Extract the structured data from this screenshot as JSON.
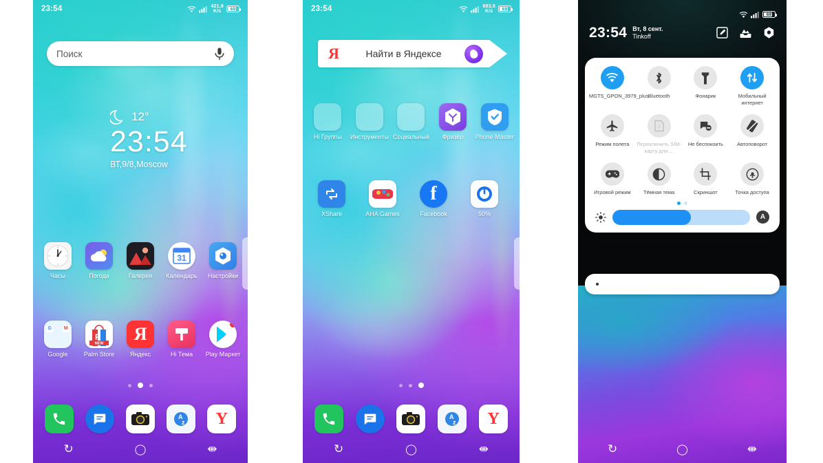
{
  "phone1": {
    "status": {
      "time": "23:54",
      "net_speed": "421,9",
      "net_unit": "K/s",
      "battery": "69"
    },
    "search": {
      "placeholder": "Поиск",
      "mic_icon": "microphone-icon"
    },
    "clock_widget": {
      "temp": "12°",
      "time": "23:54",
      "date": "ВТ,9/8,Moscow",
      "weather_icon": "moon-icon"
    },
    "row1": [
      {
        "label": "Часы",
        "icon": "clock-app-icon"
      },
      {
        "label": "Погода",
        "icon": "weather-app-icon"
      },
      {
        "label": "Галерея",
        "icon": "gallery-app-icon"
      },
      {
        "label": "Календарь",
        "icon": "calendar-app-icon",
        "badge": "31"
      },
      {
        "label": "Настройки",
        "icon": "settings-app-icon"
      }
    ],
    "row2": [
      {
        "label": "Google",
        "icon": "google-folder-icon"
      },
      {
        "label": "Palm Store",
        "icon": "palm-store-icon",
        "badge": "NEW"
      },
      {
        "label": "Яндекс",
        "icon": "yandex-app-icon"
      },
      {
        "label": "Hi Тема",
        "icon": "hi-theme-icon"
      },
      {
        "label": "Play Маркет",
        "icon": "play-store-icon"
      }
    ],
    "dock": [
      {
        "label": "phone",
        "icon": "phone-dialer-icon"
      },
      {
        "label": "messages",
        "icon": "messages-icon"
      },
      {
        "label": "camera",
        "icon": "camera-icon"
      },
      {
        "label": "translate",
        "icon": "az-translate-icon"
      },
      {
        "label": "yandex-browser",
        "icon": "yandex-browser-icon"
      }
    ],
    "pages": {
      "count": 3,
      "active": 1,
      "search_dot": true
    },
    "nav": {
      "recents": "recents-icon",
      "home": "home-icon",
      "back": "back-icon"
    }
  },
  "phone2": {
    "status": {
      "time": "23:54",
      "net_speed": "693,5",
      "net_unit": "K/s",
      "battery": "69"
    },
    "search": {
      "logo": "Я",
      "placeholder": "Найти в Яндексе",
      "assistant_icon": "alice-assistant-icon"
    },
    "row1": [
      {
        "label": "Hi Группы",
        "icon": "hi-groups-folder-icon"
      },
      {
        "label": "Инструменты",
        "icon": "tools-folder-icon"
      },
      {
        "label": "Социальный",
        "icon": "social-folder-icon"
      },
      {
        "label": "Фризер",
        "icon": "freezer-app-icon"
      },
      {
        "label": "Phone Master",
        "icon": "phone-master-icon"
      }
    ],
    "row2": [
      {
        "label": "XShare",
        "icon": "xshare-icon"
      },
      {
        "label": "AHA Games",
        "icon": "aha-games-icon"
      },
      {
        "label": "Facebook",
        "icon": "facebook-icon"
      },
      {
        "label": "50%",
        "icon": "battery-saver-icon"
      }
    ],
    "dock": [
      {
        "label": "phone",
        "icon": "phone-dialer-icon"
      },
      {
        "label": "messages",
        "icon": "messages-icon"
      },
      {
        "label": "camera",
        "icon": "camera-icon"
      },
      {
        "label": "translate",
        "icon": "az-translate-icon"
      },
      {
        "label": "yandex-browser",
        "icon": "yandex-browser-icon"
      }
    ],
    "pages": {
      "count": 3,
      "active": 2,
      "search_dot": true
    },
    "nav": {
      "recents": "recents-icon",
      "home": "home-icon",
      "back": "back-icon"
    }
  },
  "phone3": {
    "status": {
      "battery": "69"
    },
    "header": {
      "time": "23:54",
      "date": "Вт, 8 сент.",
      "carrier": "Tinkoff",
      "icons": [
        "edit-icon",
        "gallery-inbox-icon",
        "settings-gear-icon"
      ]
    },
    "tiles": [
      {
        "label": "MGTS_GPON_3979_plus",
        "icon": "wifi-icon",
        "active": true
      },
      {
        "label": "Bluetooth",
        "icon": "bluetooth-icon",
        "active": false
      },
      {
        "label": "Фонарик",
        "icon": "flashlight-icon",
        "active": false
      },
      {
        "label": "Мобильный интернет",
        "icon": "mobile-data-icon",
        "active": true
      },
      {
        "label": "Режим полета",
        "icon": "airplane-icon",
        "active": false
      },
      {
        "label": "Переключить SIM-карту для ...",
        "icon": "sim-card-icon",
        "active": false,
        "dim": true
      },
      {
        "label": "Не беспокоить",
        "icon": "do-not-disturb-icon",
        "active": false
      },
      {
        "label": "Автоповорот",
        "icon": "auto-rotate-icon",
        "active": false
      },
      {
        "label": "Игровой режим",
        "icon": "gamepad-icon",
        "active": false
      },
      {
        "label": "Тёмная тема",
        "icon": "dark-theme-icon",
        "active": false
      },
      {
        "label": "Скриншот",
        "icon": "screenshot-icon",
        "active": false
      },
      {
        "label": "Точка доступа",
        "icon": "hotspot-icon",
        "active": false
      }
    ],
    "pager": {
      "count": 2,
      "active": 1
    },
    "brightness": {
      "value": 57,
      "icon": "brightness-icon",
      "auto_label": "A"
    },
    "notification": {
      "placeholder": ""
    },
    "nav": {
      "recents": "recents-icon",
      "home": "home-icon",
      "back": "back-icon"
    }
  }
}
